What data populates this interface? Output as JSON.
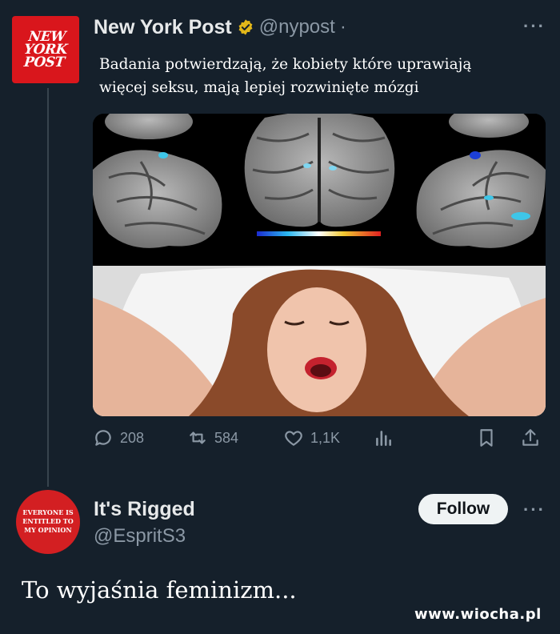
{
  "post": {
    "author_name": "New York Post",
    "handle": "@nypost",
    "handle_separator": "·",
    "avatar_logo": "NEW YORK POST",
    "text_line1": "Badania potwierdzają, że kobiety które uprawiają",
    "text_line2": "więcej seksu, mają lepiej rozwinięte mózgi",
    "more_icon": "more-dots-icon",
    "verified_color": "#e2b719",
    "stats": {
      "replies": "208",
      "reposts": "584",
      "likes": "1,1K"
    },
    "action_icons": [
      "reply-icon",
      "repost-icon",
      "like-icon",
      "views-icon",
      "bookmark-icon",
      "share-icon"
    ]
  },
  "reply": {
    "author_name": "It's Rigged",
    "handle": "@EspritS3",
    "avatar_logo": "EVERYONE IS ENTITLED TO MY OPINION",
    "follow_label": "Follow"
  },
  "caption": "To wyjaśnia feminizm...",
  "watermark": "www.wiocha.pl",
  "colors": {
    "background": "#15202b",
    "accent_red": "#d9161c",
    "muted_text": "#8b98a5"
  }
}
